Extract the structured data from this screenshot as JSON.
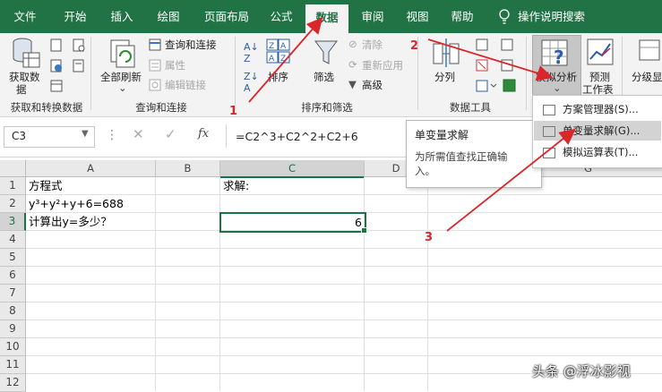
{
  "tabs": [
    "文件",
    "开始",
    "插入",
    "绘图",
    "页面布局",
    "公式",
    "数据",
    "审阅",
    "视图",
    "帮助",
    "操作说明搜索"
  ],
  "ribbon": {
    "get_data_label_1": "获取数",
    "get_data_label_2": "据",
    "refresh_all_label": "全部刷新",
    "queries_connections": "查询和连接",
    "properties": "属性",
    "edit_links": "编辑链接",
    "sort_label": "排序",
    "filter_label": "筛选",
    "clear_label": "清除",
    "reapply_label": "重新应用",
    "advanced_label": "高级",
    "text_to_columns": "分列",
    "whatif_label_1": "模拟分析",
    "forecast_label_1": "预测",
    "forecast_label_2": "工作表",
    "outline_label": "分级显",
    "group1": "获取和转换数据",
    "group2": "查询和连接",
    "group3": "排序和筛选",
    "group4": "数据工具"
  },
  "formula_bar": {
    "name_box": "C3",
    "fx": "fx",
    "formula": "=C2^3+C2^2+C2+6"
  },
  "grid": {
    "columns": [
      "A",
      "B",
      "C",
      "D",
      "G"
    ],
    "rows": [
      "1",
      "2",
      "3",
      "4",
      "5",
      "6",
      "7",
      "8",
      "9",
      "10",
      "11",
      "12",
      "13"
    ],
    "A1": "方程式",
    "A2": "y³+y²+y+6=688",
    "A3": "计算出y=多少？",
    "C1": "求解:",
    "C3": "6"
  },
  "whatif_menu": {
    "items": [
      "方案管理器(S)...",
      "单变量求解(G)...",
      "模拟运算表(T)..."
    ]
  },
  "tooltip": {
    "title": "单变量求解",
    "body_1": "为所需值查找正确输",
    "body_2": "入。"
  },
  "annotations": {
    "n1": "1",
    "n2": "2",
    "n3": "3",
    "arrow_color": "#d9262b"
  },
  "watermark": "头条 @浮冰影视",
  "colors": {
    "excel_green": "#217346",
    "ribbon_bg": "#f3f3f3",
    "selection_green": "#1e7145"
  }
}
